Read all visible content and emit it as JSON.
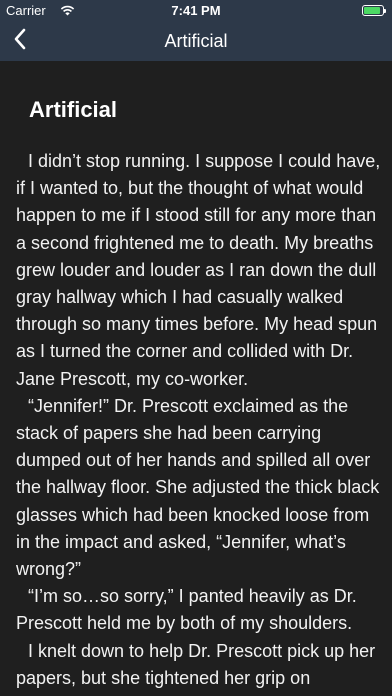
{
  "status_bar": {
    "carrier": "Carrier",
    "time": "7:41 PM",
    "battery_level": 0.9,
    "icons": [
      "wifi-icon",
      "battery-icon"
    ]
  },
  "nav_bar": {
    "title": "Artificial",
    "back_icon": "chevron-left-icon",
    "background": "#2d3949"
  },
  "chapter": {
    "title": "Artificial",
    "paragraphs": [
      "I didn’t stop running. I suppose I could have, if I wanted to, but the thought of what would happen to me if I stood still for any more than a second frightened me to death. My breaths grew louder and louder as I ran down the dull gray hallway which I had casually walked through so many times before. My head spun as I turned the corner and collided with Dr. Jane Prescott, my co-worker.",
      "“Jennifer!” Dr. Prescott exclaimed as the stack of papers she had been carrying dumped out of her hands and spilled all over the hallway floor. She adjusted the thick black glasses which had been knocked loose from in the impact and asked, “Jennifer, what’s wrong?”",
      "“I’m so…so sorry,” I panted heavily as Dr. Prescott held me by both of my shoulders.",
      "I knelt down to help Dr. Prescott pick up her papers, but she tightened her grip on"
    ]
  },
  "colors": {
    "background": "#1f1f1f",
    "text": "#ffffff",
    "battery": "#4cd964"
  }
}
